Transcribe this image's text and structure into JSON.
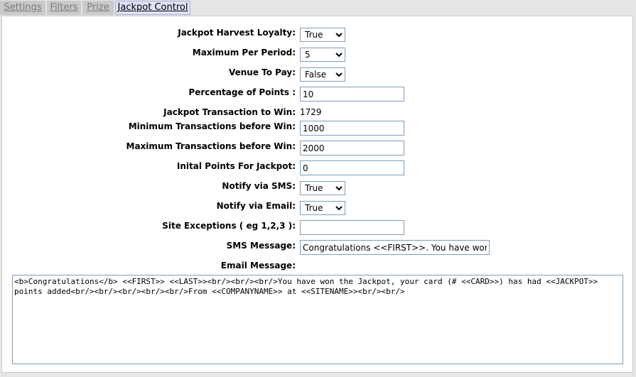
{
  "tabs": {
    "settings": "Settings",
    "filters": "Filters",
    "prize": "Prize",
    "jackpot_control": "Jackpot Control"
  },
  "form": {
    "harvest_loyalty": {
      "label": "Jackpot Harvest Loyalty:",
      "value": "True"
    },
    "max_per_period": {
      "label": "Maximum Per Period:",
      "value": "5"
    },
    "venue_to_pay": {
      "label": "Venue To Pay:",
      "value": "False"
    },
    "percentage_points": {
      "label": "Percentage of Points :",
      "value": "10"
    },
    "transaction_to_win": {
      "label": "Jackpot Transaction to Win:",
      "value": "1729"
    },
    "min_transactions": {
      "label": "Minimum Transactions before Win:",
      "value": "1000"
    },
    "max_transactions": {
      "label": "Maximum Transactions before Win:",
      "value": "2000"
    },
    "initial_points": {
      "label": "Inital Points For Jackpot:",
      "value": "0"
    },
    "notify_sms": {
      "label": "Notify via SMS:",
      "value": "True"
    },
    "notify_email": {
      "label": "Notify via Email:",
      "value": "True"
    },
    "site_exceptions": {
      "label": "Site Exceptions ( eg 1,2,3 ):",
      "value": ""
    },
    "sms_message": {
      "label": "SMS Message:",
      "value": "Congratulations <<FIRST>>. You have won the"
    },
    "email_message": {
      "label": "Email Message:",
      "value": "<b>Congratulations</b> <<FIRST>> <<LAST>><br/><br/><br/>You have won the Jackpot, your card (# <<CARD>>) has had <<JACKPOT>> points added<br/><br/><br/><br/><br/>From <<COMPANYNAME>> at <<SITENAME>><br/><br/>"
    }
  },
  "colors": {
    "active_tab_bg": "#dde1f5",
    "inactive_tab_bg": "#c9c9c9",
    "field_border": "#7f9db9"
  }
}
